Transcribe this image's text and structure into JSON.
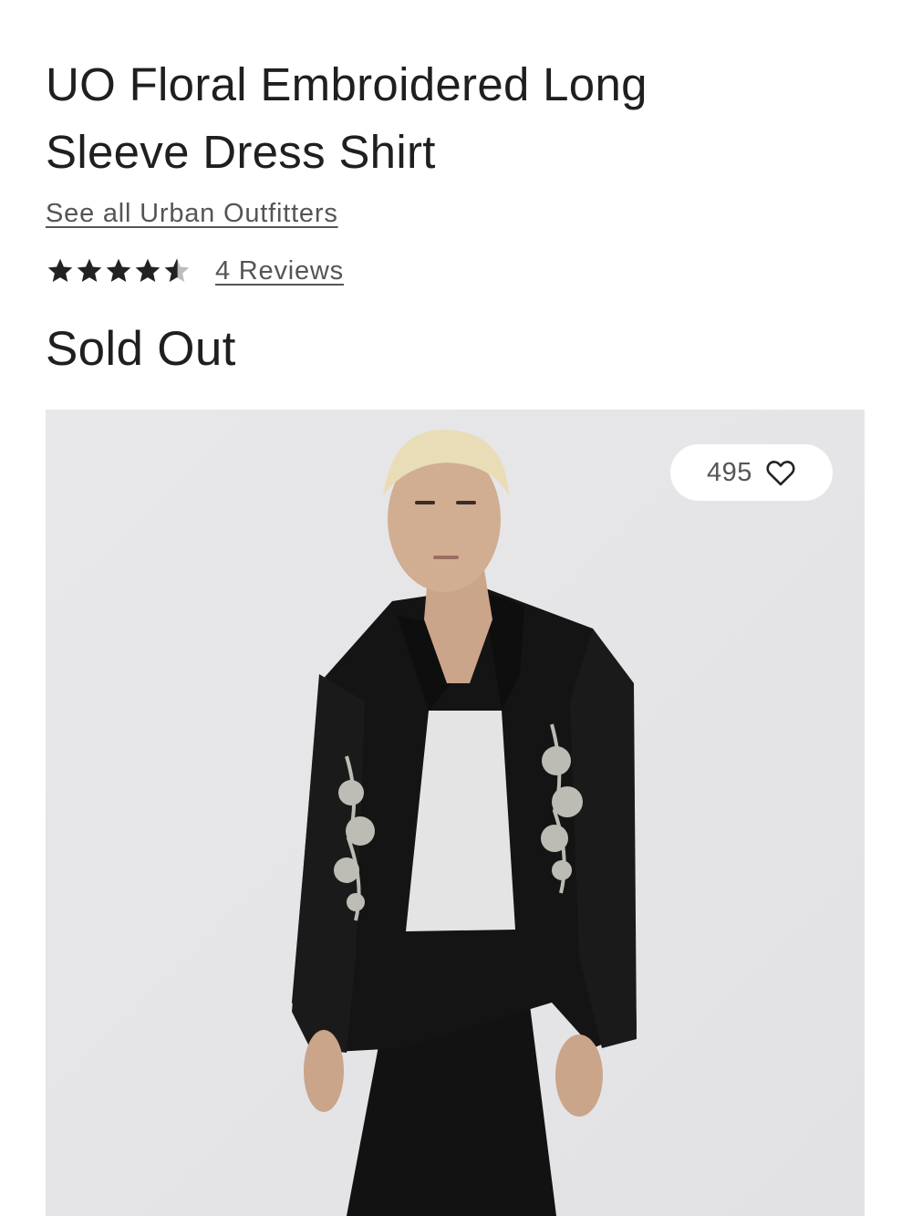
{
  "product": {
    "title": "UO Floral Embroidered Long Sleeve Dress Shirt",
    "brand_link": "See all Urban Outfitters",
    "rating": {
      "value_out_of_5": 4.5,
      "reviews_label": "4 Reviews"
    },
    "availability": "Sold Out"
  },
  "image": {
    "wishlist_count": "495",
    "wishlist_icon": "heart-outline-icon"
  },
  "colors": {
    "text": "#1f1f1f",
    "link": "#555555",
    "star_filled": "#222222",
    "star_empty": "#bdbdbd",
    "image_background": "#e6e6e8"
  }
}
